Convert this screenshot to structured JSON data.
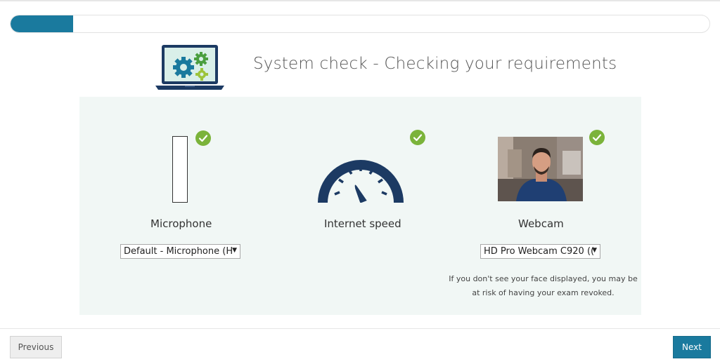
{
  "progress": {
    "value": 0.09
  },
  "header": {
    "title": "System check - Checking your requirements",
    "icon": "laptop-gears-icon"
  },
  "checks": {
    "microphone": {
      "label": "Microphone",
      "select_value": "Default - Microphone (H",
      "status": "passed",
      "icon": "check-icon"
    },
    "internet": {
      "label": "Internet speed",
      "status": "passed",
      "icon": "speedometer-icon"
    },
    "webcam": {
      "label": "Webcam",
      "select_value": "HD Pro Webcam C920 ((",
      "status": "passed",
      "note_line1": "If you don't see your face displayed, you may be",
      "note_line2": "at risk of having your exam revoked."
    }
  },
  "footer": {
    "previous_label": "Previous",
    "next_label": "Next"
  },
  "colors": {
    "accent": "#1a7a9e",
    "check_green": "#7bb33a",
    "panel_bg": "#f1f7f5",
    "gauge_navy": "#1c3a63"
  }
}
